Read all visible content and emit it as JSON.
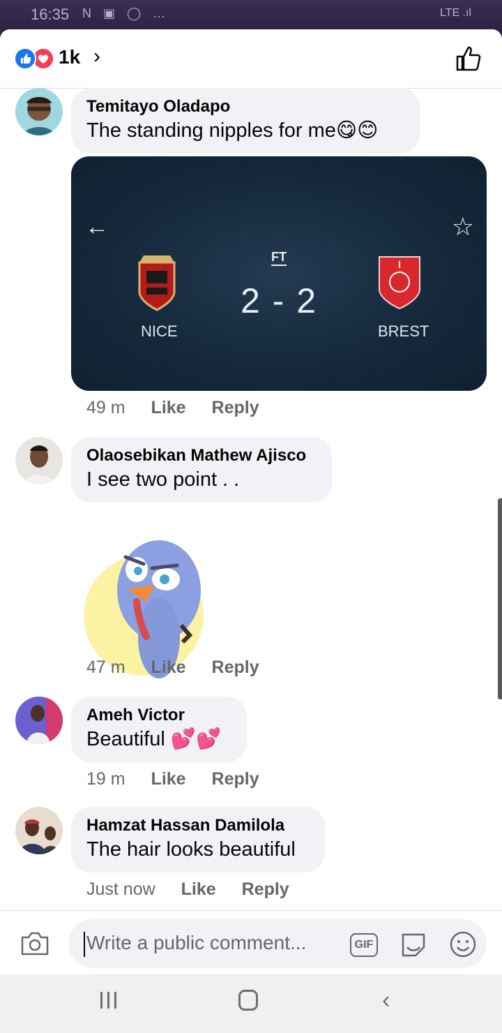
{
  "status_bar": {
    "time": "16:35",
    "notification_icons": "N ▣ ◯ …",
    "right": "LTE .ıl"
  },
  "header": {
    "reaction_count": "1k",
    "reaction_icons": [
      "like-icon",
      "love-icon"
    ],
    "accent_like": "#1877f2",
    "accent_love": "#f33e58"
  },
  "comments": [
    {
      "author": "Temitayo Oladapo",
      "text": "The standing nipples for me😋😊",
      "attachment": {
        "type": "screenshot",
        "status": "FT",
        "score": "2 - 2",
        "home_team": "NICE",
        "away_team": "BREST"
      },
      "time": "49 m",
      "like_label": "Like",
      "reply_label": "Reply"
    },
    {
      "author": "Olaosebikan Mathew Ajisco",
      "text": "I see two point . .",
      "attachment": {
        "type": "sticker",
        "icon": "turkey-sticker"
      },
      "time": "47 m",
      "like_label": "Like",
      "reply_label": "Reply"
    },
    {
      "author": "Ameh Victor",
      "text": "Beautiful 💕💕",
      "time": "19 m",
      "like_label": "Like",
      "reply_label": "Reply"
    },
    {
      "author": "Hamzat Hassan Damilola",
      "text": "The hair looks beautiful",
      "time": "Just now",
      "like_label": "Like",
      "reply_label": "Reply"
    }
  ],
  "composer": {
    "placeholder": "Write a public comment...",
    "gif_label": "GIF"
  }
}
